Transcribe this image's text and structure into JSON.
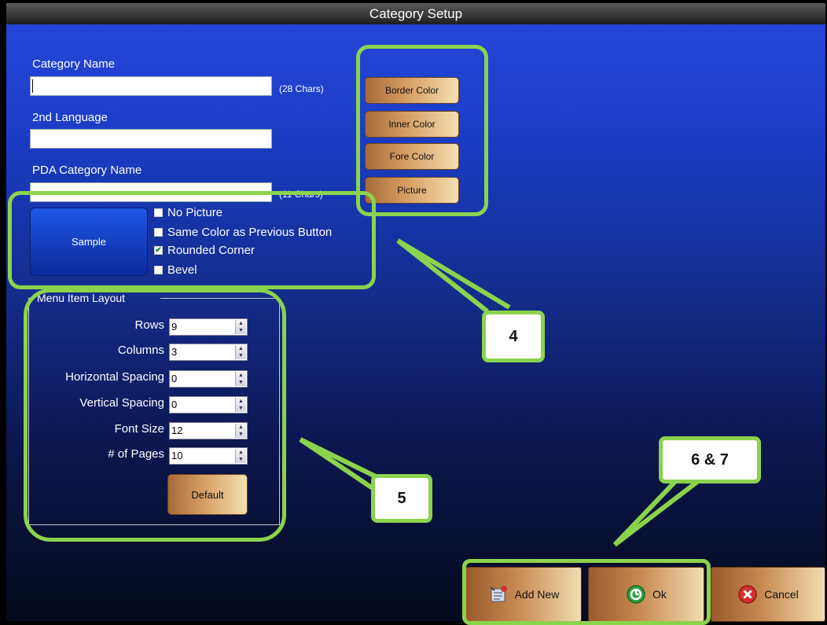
{
  "window": {
    "title": "Category Setup"
  },
  "form": {
    "category_name_label": "Category Name",
    "category_name_value": "",
    "category_name_hint": "(28 Chars)",
    "second_language_label": "2nd Language",
    "second_language_value": "",
    "pda_name_label": "PDA Category Name",
    "pda_name_value": "",
    "pda_name_hint": "(11 Chars)"
  },
  "color_buttons": {
    "border_color": "Border Color",
    "inner_color": "Inner Color",
    "fore_color": "Fore Color",
    "picture": "Picture"
  },
  "sample": {
    "label": "Sample",
    "color": "#1e56e6"
  },
  "options": [
    {
      "label": "No Picture",
      "checked": false
    },
    {
      "label": "Same Color as Previous Button",
      "checked": false
    },
    {
      "label": "Rounded Corner",
      "checked": true
    },
    {
      "label": "Bevel",
      "checked": false
    }
  ],
  "layout_group": {
    "title": "Menu Item Layout",
    "rows": [
      {
        "label": "Rows",
        "value": "9"
      },
      {
        "label": "Columns",
        "value": "3"
      },
      {
        "label": "Horizontal Spacing",
        "value": "0"
      },
      {
        "label": "Vertical Spacing",
        "value": "0"
      },
      {
        "label": "Font Size",
        "value": "12"
      },
      {
        "label": "# of Pages",
        "value": "10"
      }
    ],
    "default_button": "Default"
  },
  "footer": {
    "add_new": {
      "label": "Add New",
      "icon": "add-new-icon"
    },
    "ok": {
      "label": "Ok",
      "icon": "ok-icon"
    },
    "cancel": {
      "label": "Cancel",
      "icon": "cancel-icon"
    }
  },
  "annotations": {
    "a4": "4",
    "a5": "5",
    "a67": "6 & 7",
    "highlight_color": "#8bd34c"
  }
}
